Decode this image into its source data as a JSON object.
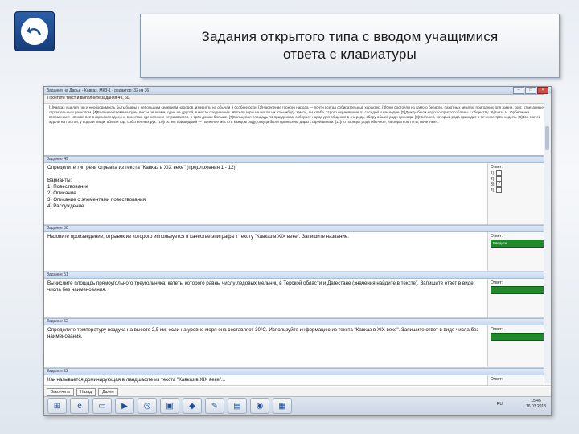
{
  "slide": {
    "title": "Задания открытого типа с вводом учащимися\nответа с клавиатуры"
  },
  "window": {
    "title": "Задания на Дарьи - Кавказ. МКЗ-1 - редактор: 32 из 36",
    "instruction": "Прочтите текст и выполните задания 49, 50."
  },
  "passage": "[1]Кавказ ущелья гор и необходимость быть бодры к небольшим селениям народов, изменять на обычаи и особенности. [2]Население горного народа — почти всегда собирательный характер. [3]Они состояли из самого бедного, пахотных землях, пригодных для жизни, скот, отрезанные строительным раскопом. [4]Вольные племена сумы вести пешками, один на другой, в месте соединения. Жители горы не могли ни что-нибудь земли, ни хлеба, строго охранявшие от соседей и наследие. [5]Дождь были хорошо приспособлены к обществу. [6]Князь И. Орбелиани вспоминает: «Зимой всё в горах холодно, но в местах, где селение устраивается, в трёх домах больше. [7]Кольцевая площадь по праздникам собирает народ для общения в очередь, сбору общей ради прохода. [8]Жителей, который рода приходит в течение трёх недель. [9]Все гостей ждали на постой, у воды и пищи, вблизи гор, собственных рук. [10]Гостем пришедший — почётное место в каждом роду, откуда были принесены дары старейшинам. [11]По порядку рода обычное, на обратном пути, почётные...",
  "tasks": [
    {
      "header": "Задание 49",
      "question": "Определите тип речи отрывка из текста \"Кавказ в XIX веке\" (предложения 1 - 12).",
      "variants_label": "Варианты:",
      "options": [
        "1) Повествование",
        "2) Описание",
        "3) Описание с элементами повествования",
        "4) Рассуждение"
      ],
      "answer_label": "Ответ:",
      "checks": [
        {
          "n": "1)",
          "mark": ""
        },
        {
          "n": "2)",
          "mark": ""
        },
        {
          "n": "3)",
          "mark": "✓"
        },
        {
          "n": "4)",
          "mark": ""
        }
      ]
    },
    {
      "header": "Задание 50",
      "question": "Назовите произведение, отрывок из которого используется в качестве эпиграфа к тексту \"Кавказ в XIX веке\". Запишите название.",
      "answer_label": "Ответ:",
      "answer_value": "Введите"
    },
    {
      "header": "Задание 51",
      "question": "Вычислите площадь прямоугольного треугольника, катеты которого равны числу ледовых мельниц в Терской области и Дагестане (значения найдите в тексте). Запишите ответ в виде числа без наименования.",
      "answer_label": "Ответ:",
      "answer_value": ""
    },
    {
      "header": "Задание 52",
      "question": "Определите температуру воздуха на высоте 2,5 км, если на уровне моря она составляет 30°С. Используйте информацию из текста \"Кавказ в XIX веке\". Запишите ответ в виде числа без наименования.",
      "answer_label": "Ответ:",
      "answer_value": ""
    },
    {
      "header": "Задание 53",
      "question": "Как называется доминирующая в ландшафте из текста \"Кавказ в XIX веке\"...",
      "answer_label": "Ответ:"
    }
  ],
  "toolbar": {
    "finish": "Закончить",
    "prev": "Назад",
    "next": "Далее"
  },
  "tray": {
    "lang": "RU",
    "time": "15:45",
    "date": "16.03.2013"
  }
}
